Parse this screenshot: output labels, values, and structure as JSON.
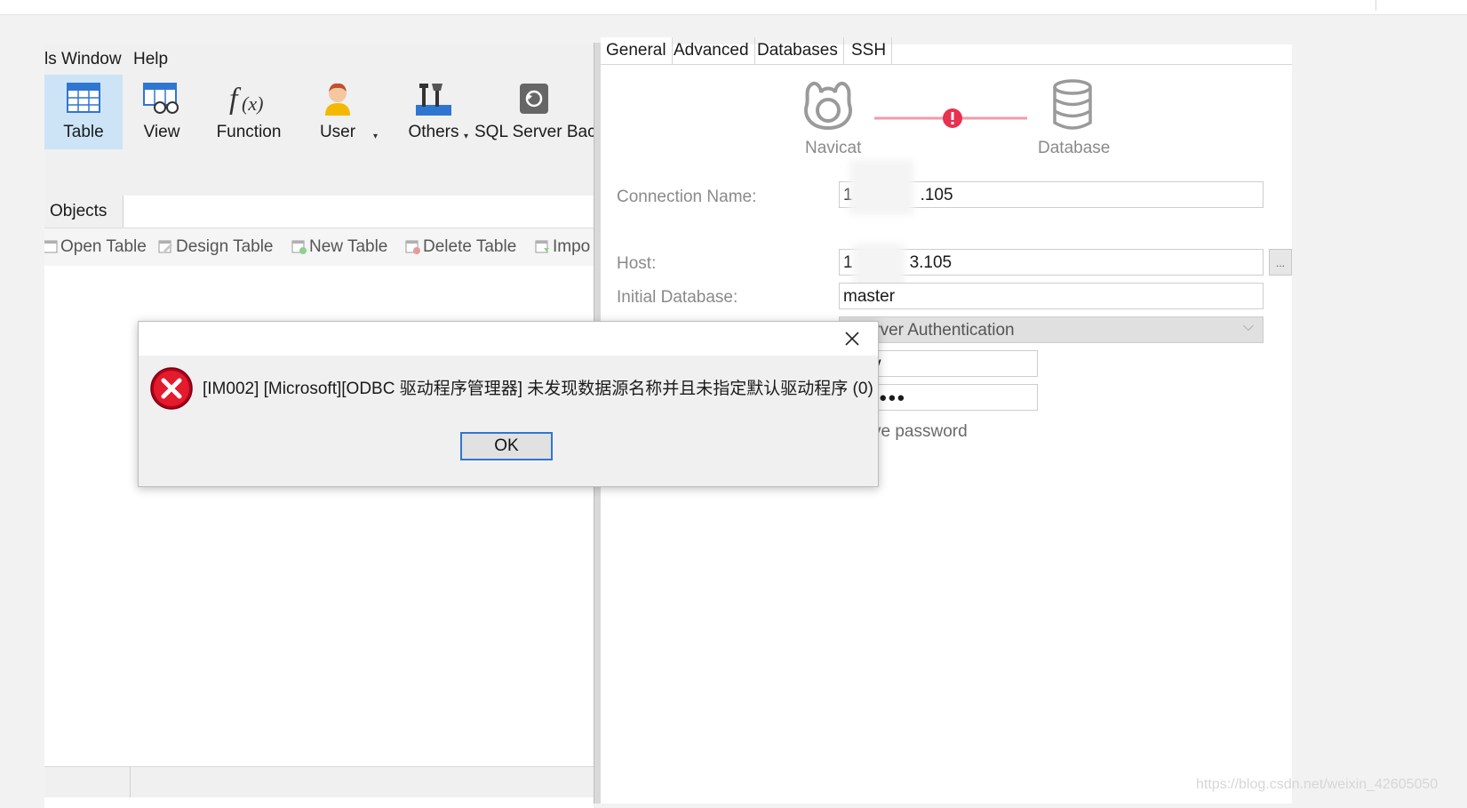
{
  "menu": {
    "items": [
      "ls",
      "Window",
      "Help"
    ]
  },
  "toolbar": {
    "buttons": [
      {
        "label": "Table"
      },
      {
        "label": "View"
      },
      {
        "label": "Function"
      },
      {
        "label": "User"
      },
      {
        "label": "Others"
      },
      {
        "label": "SQL Server Bac"
      }
    ]
  },
  "objects_tab": "Objects",
  "subtoolbar": {
    "items": [
      "Open Table",
      "Design Table",
      "New Table",
      "Delete Table",
      "Impo"
    ]
  },
  "connection": {
    "tabs": [
      "General",
      "Advanced",
      "Databases",
      "SSH"
    ],
    "diagram": {
      "left_label": "Navicat",
      "right_label": "Database"
    },
    "fields": {
      "connection_name": {
        "label": "Connection Name:",
        "value_prefix": "1",
        "value_suffix": ".105"
      },
      "host": {
        "label": "Host:",
        "value_prefix": "1",
        "value_suffix": "3.105"
      },
      "initial_database": {
        "label": "Initial Database:",
        "value": "master"
      },
      "authentication": {
        "value": "Server Authentication"
      },
      "username": {
        "value": "dev"
      },
      "password": {
        "value": "●●●●●●"
      },
      "save_password": {
        "label": "ve password"
      }
    },
    "browse_label": "..."
  },
  "error_dialog": {
    "message": "[IM002] [Microsoft][ODBC 驱动程序管理器] 未发现数据源名称并且未指定默认驱动程序 (0)",
    "ok_label": "OK"
  },
  "watermark": "https://blog.csdn.net/weixin_42605050",
  "colors": {
    "accent": "#2f76d1",
    "error": "#c8102e",
    "connector": "#f29aa8",
    "warning_dot": "#e8304f"
  }
}
